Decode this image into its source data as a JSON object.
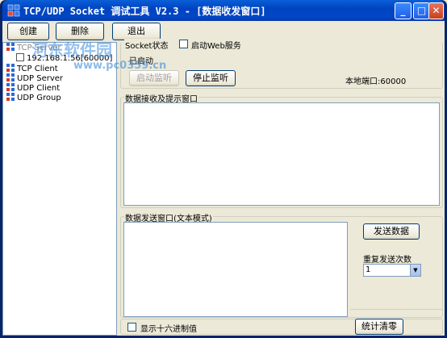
{
  "window": {
    "title": "TCP/UDP Socket 调试工具 V2.3 - [数据收发窗口]",
    "minimize_glyph": "_",
    "maximize_glyph": "□",
    "close_glyph": "✕"
  },
  "watermark": {
    "text": "河东软件园",
    "url": "www.pc0359.cn"
  },
  "toolbar": {
    "create_label": "创建",
    "delete_label": "删除",
    "exit_label": "退出"
  },
  "tree": {
    "items": [
      {
        "label": "TCP Server",
        "level": 0
      },
      {
        "label": "192.168.1.56[60000]",
        "level": 1
      },
      {
        "label": "TCP Client",
        "level": 0
      },
      {
        "label": "UDP Server",
        "level": 0
      },
      {
        "label": "UDP Client",
        "level": 0
      },
      {
        "label": "UDP Group",
        "level": 0
      }
    ]
  },
  "socket_status": {
    "group_label": "Socket状态",
    "web_service_label": "启动Web服务",
    "state_text": "已启动",
    "start_listen_label": "启动监听",
    "stop_listen_label": "停止监听",
    "local_port_text": "本地端口:60000"
  },
  "receive": {
    "group_label": "数据接收及提示窗口"
  },
  "send": {
    "group_label": "数据发送窗口(文本模式)",
    "send_button_label": "发送数据",
    "repeat_label": "重复发送次数",
    "repeat_value": "1"
  },
  "footer": {
    "hex_label": "显示十六进制值",
    "stats_clear_label": "统计清零"
  },
  "colors": {
    "titlebar": "#0054e3",
    "face": "#ece9d8",
    "field_bg": "#ffffff"
  }
}
